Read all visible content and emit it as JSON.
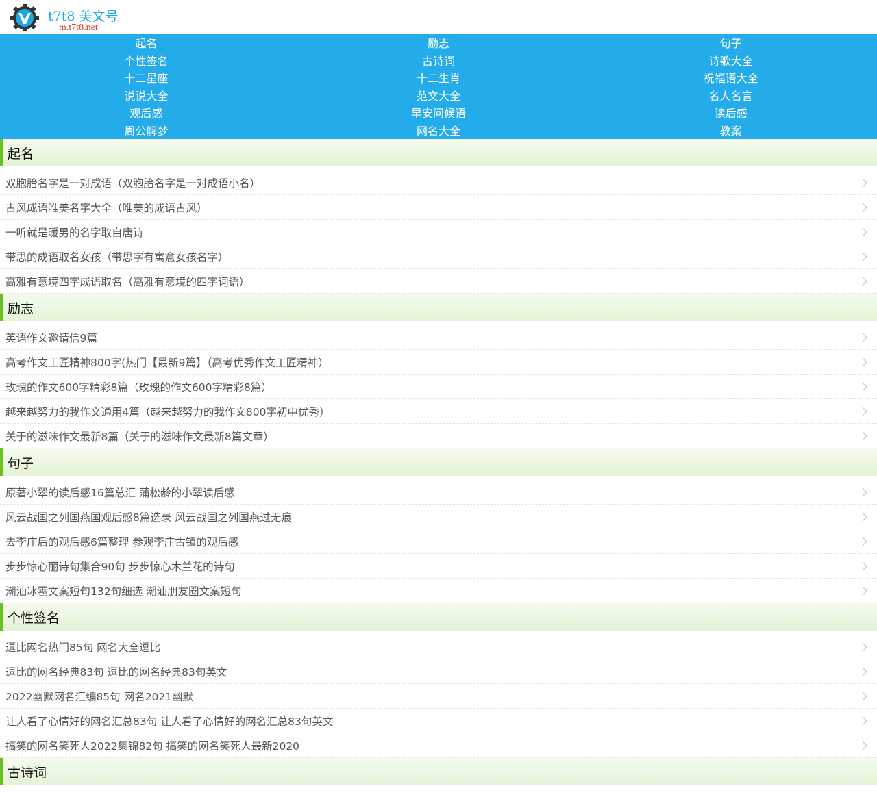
{
  "header": {
    "site_name_ascii": "t7t8",
    "site_name_cn": "美文号",
    "site_url": "m.t7t8.net",
    "logo_icon": "gear-logo-icon",
    "brand_color": "#24acea"
  },
  "nav": {
    "items": [
      {
        "label": "起名"
      },
      {
        "label": "励志"
      },
      {
        "label": "句子"
      },
      {
        "label": "个性签名"
      },
      {
        "label": "古诗词"
      },
      {
        "label": "诗歌大全"
      },
      {
        "label": "十二星座"
      },
      {
        "label": "十二生肖"
      },
      {
        "label": "祝福语大全"
      },
      {
        "label": "说说大全"
      },
      {
        "label": "范文大全"
      },
      {
        "label": "名人名言"
      },
      {
        "label": "观后感"
      },
      {
        "label": "早安问候语"
      },
      {
        "label": "读后感"
      },
      {
        "label": "周公解梦"
      },
      {
        "label": "网名大全"
      },
      {
        "label": "教案"
      }
    ]
  },
  "sections": [
    {
      "title": "起名",
      "items": [
        "双胞胎名字是一对成语（双胞胎名字是一对成语小名）",
        "古风成语唯美名字大全（唯美的成语古风）",
        "一听就是暖男的名字取自唐诗",
        "带思的成语取名女孩（带思字有寓意女孩名字）",
        "高雅有意境四字成语取名（高雅有意境的四字词语）"
      ]
    },
    {
      "title": "励志",
      "items": [
        "英语作文邀请信9篇",
        "高考作文工匠精神800字(热门【最新9篇】（高考优秀作文工匠精神）",
        "玫瑰的作文600字精彩8篇（玫瑰的作文600字精彩8篇）",
        "越来越努力的我作文通用4篇（越来越努力的我作文800字初中优秀）",
        "关于的滋味作文最新8篇（关于的滋味作文最新8篇文章）"
      ]
    },
    {
      "title": "句子",
      "items": [
        "原著小翠的读后感16篇总汇 蒲松龄的小翠读后感",
        "风云战国之列国燕国观后感8篇选录 风云战国之列国燕过无痕",
        "去李庄后的观后感6篇整理 参观李庄古镇的观后感",
        "步步惊心丽诗句集合90句 步步惊心木兰花的诗句",
        "潮汕冰雹文案短句132句细选 潮汕朋友圈文案短句"
      ]
    },
    {
      "title": "个性签名",
      "items": [
        "逗比网名热门85句 网名大全逗比",
        "逗比的网名经典83句 逗比的网名经典83句英文",
        "2022幽默网名汇编85句 网名2021幽默",
        "让人看了心情好的网名汇总83句 让人看了心情好的网名汇总83句英文",
        "搞笑的网名笑死人2022集锦82句 搞笑的网名笑死人最新2020"
      ]
    },
    {
      "title": "古诗词",
      "items": []
    }
  ]
}
